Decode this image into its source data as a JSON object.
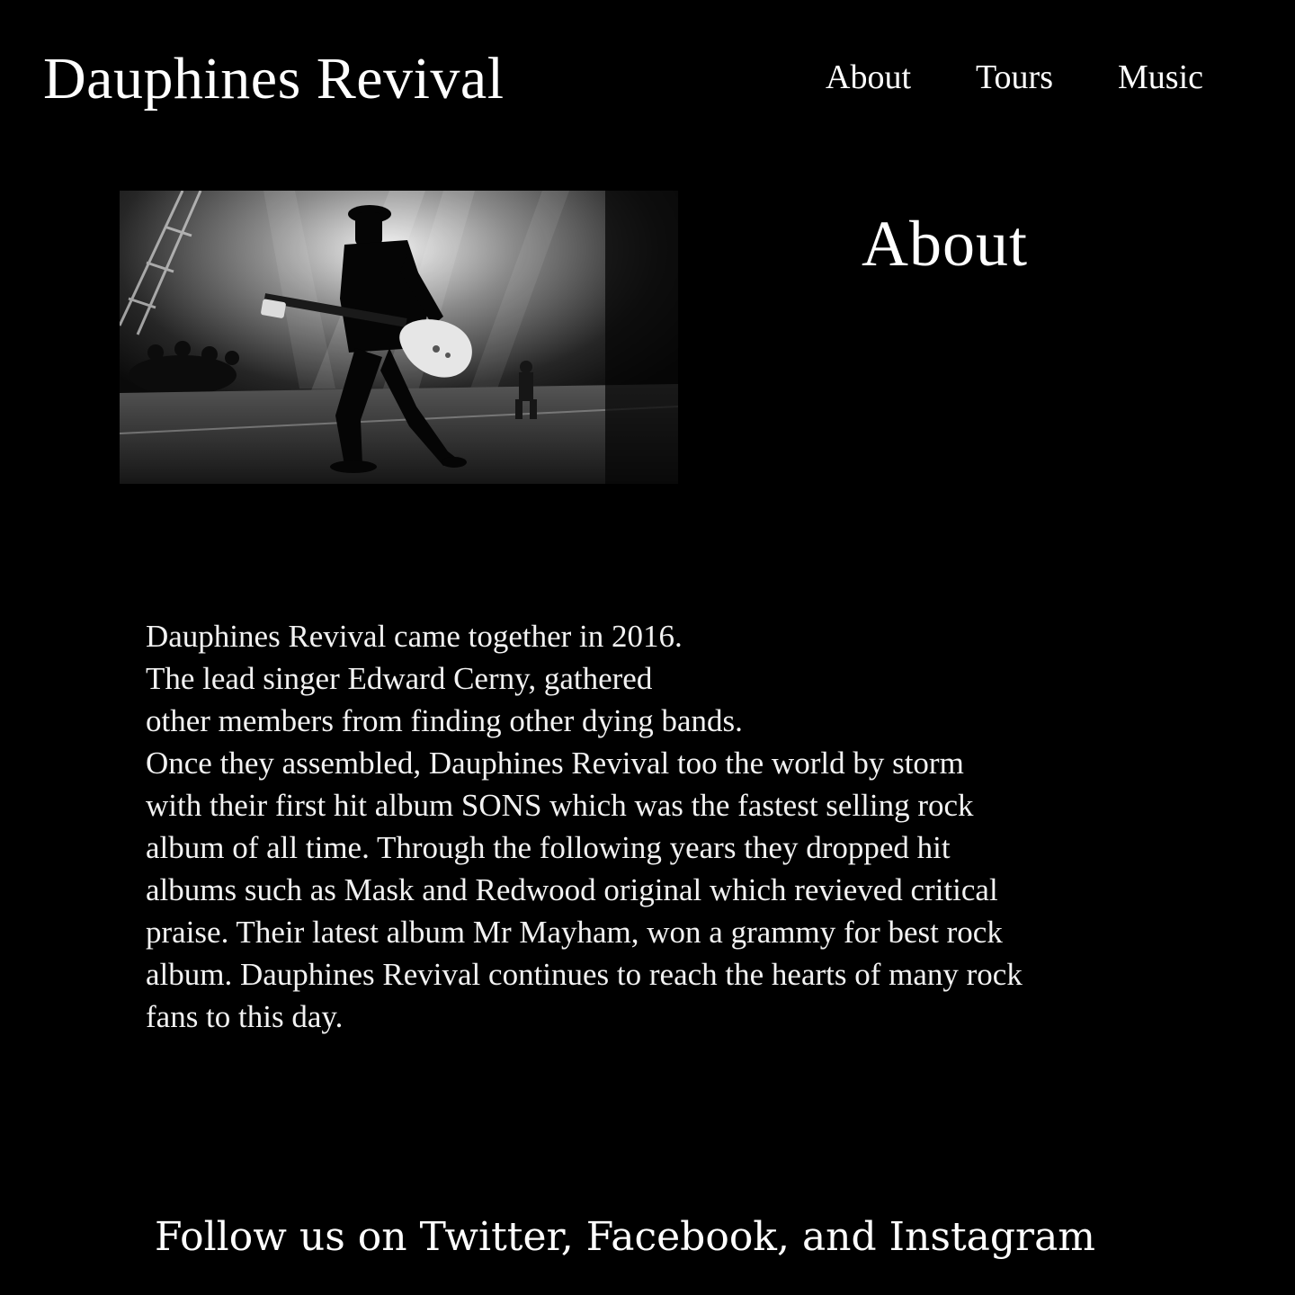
{
  "header": {
    "site_title": "Dauphines Revival",
    "nav": [
      {
        "label": "About"
      },
      {
        "label": "Tours"
      },
      {
        "label": "Music"
      }
    ]
  },
  "main": {
    "hero_image": {
      "icon": "concert-guitarist-photo",
      "style": "black-and-white"
    },
    "section_heading": "About",
    "bio_lines": [
      "Dauphines Revival came together in 2016.",
      "The lead singer Edward Cerny, gathered",
      "other members from finding other dying bands.",
      "Once they assembled, Dauphines Revival too the world by storm",
      "with their first hit album SONS which was the fastest selling rock",
      "album of all time. Through the following years they dropped hit",
      "albums such as Mask and Redwood original which revieved critical",
      "praise. Their latest album Mr Mayham, won a grammy for best rock",
      "album. Dauphines Revival continues to reach the hearts of many rock",
      "fans to this day."
    ]
  },
  "footer": {
    "follow_text": "Follow us on Twitter, Facebook, and Instagram"
  },
  "colors": {
    "background": "#000000",
    "text": "#ffffff"
  }
}
